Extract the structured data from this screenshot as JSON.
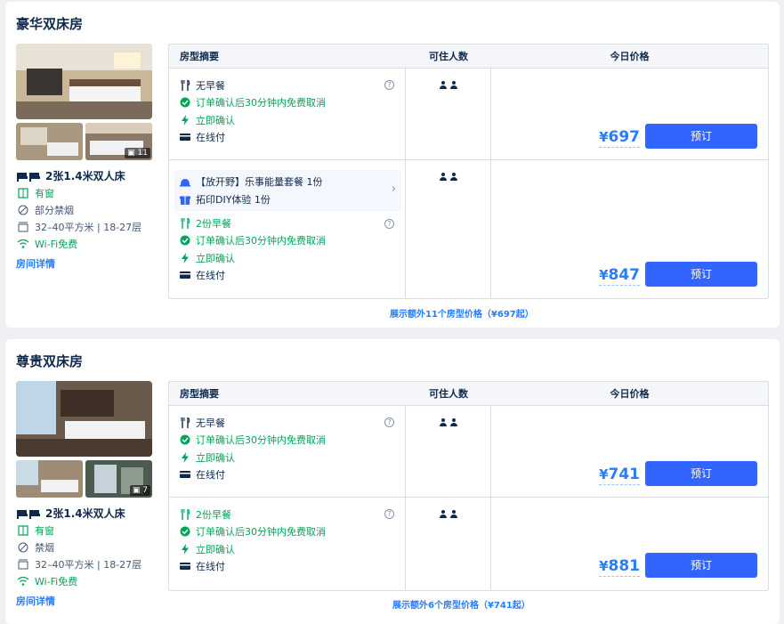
{
  "table_headers": {
    "summary": "房型摘要",
    "occupancy": "可住人数",
    "price": "今日价格"
  },
  "rooms": [
    {
      "title": "豪华双床房",
      "photo_count": "11",
      "bed": "2张1.4米双人床",
      "window": "有窗",
      "smoking": "部分禁烟",
      "area_floor": "32–40平方米 | 18-27层",
      "wifi": "Wi-Fi免费",
      "details_link": "房间详情",
      "more_prices": "展示额外11个房型价格（¥697起）",
      "rates": [
        {
          "breakfast": "无早餐",
          "cancel": "订单确认后30分钟内免费取消",
          "confirm": "立即确认",
          "payment": "在线付",
          "price": "697",
          "book": "预订"
        },
        {
          "package_items": [
            "【放开野】乐事能量套餐 1份",
            "拓印DIY体验 1份"
          ],
          "breakfast": "2份早餐",
          "cancel": "订单确认后30分钟内免费取消",
          "confirm": "立即确认",
          "payment": "在线付",
          "price": "847",
          "book": "预订"
        }
      ]
    },
    {
      "title": "尊贵双床房",
      "photo_count": "7",
      "bed": "2张1.4米双人床",
      "window": "有窗",
      "smoking": "禁烟",
      "area_floor": "32–40平方米 | 18-27层",
      "wifi": "Wi-Fi免费",
      "details_link": "房间详情",
      "more_prices": "展示额外6个房型价格（¥741起）",
      "rates": [
        {
          "breakfast": "无早餐",
          "cancel": "订单确认后30分钟内免费取消",
          "confirm": "立即确认",
          "payment": "在线付",
          "price": "741",
          "book": "预订"
        },
        {
          "breakfast": "2份早餐",
          "cancel": "订单确认后30分钟内免费取消",
          "confirm": "立即确认",
          "payment": "在线付",
          "price": "881",
          "book": "预订"
        }
      ]
    }
  ],
  "currency": "¥",
  "icons": [
    "bed-icon",
    "window-icon",
    "smoking-icon",
    "area-icon",
    "wifi-icon",
    "utensils-icon",
    "check-circle-icon",
    "lightning-icon",
    "card-icon",
    "help-icon",
    "person-icon",
    "gift-icon",
    "bell-icon",
    "image-icon"
  ],
  "colors": {
    "accent": "#287dfa",
    "button": "#3264ff",
    "green": "#00a55a"
  }
}
